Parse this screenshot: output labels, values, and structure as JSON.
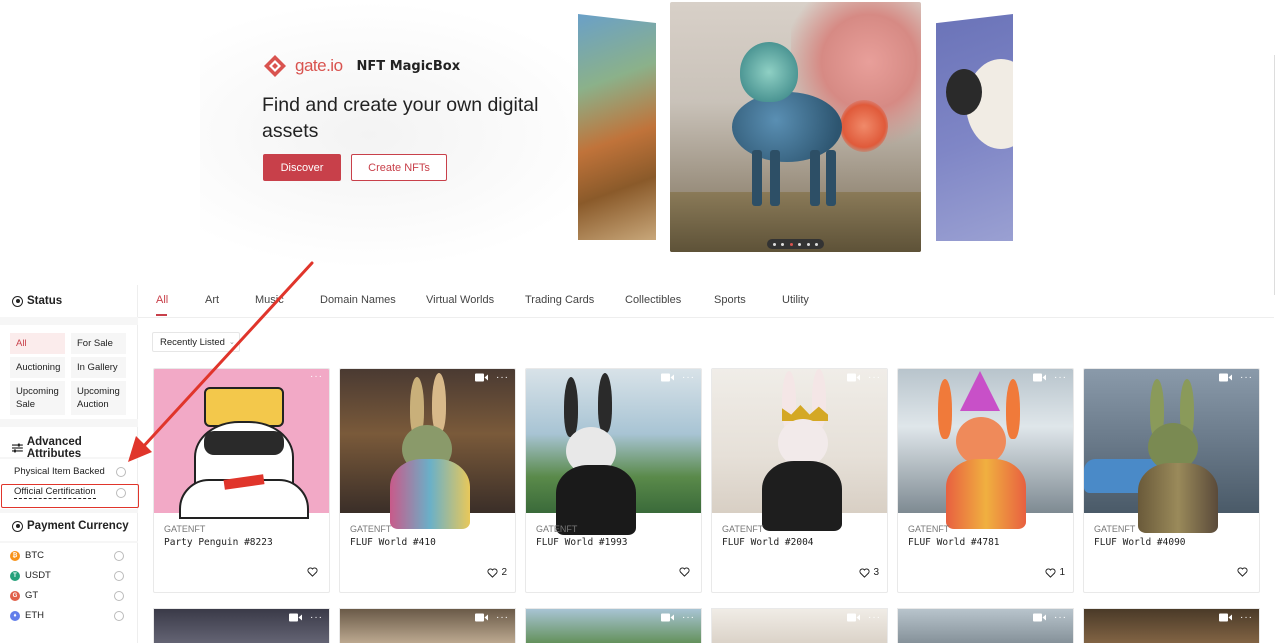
{
  "hero": {
    "brand_gate": "gate.io",
    "brand_name": "NFT MagicBox",
    "headline": "Find and create your own digital assets",
    "discover_label": "Discover",
    "create_label": "Create NFTs",
    "carousel_dots": 6,
    "carousel_active_index": 2
  },
  "sidebar": {
    "status_title": "Status",
    "status_buttons": [
      {
        "label": "All",
        "active": true
      },
      {
        "label": "For Sale",
        "active": false
      },
      {
        "label": "Auctioning",
        "active": false
      },
      {
        "label": "In Gallery",
        "active": false
      },
      {
        "label": "Upcoming Sale",
        "active": false
      },
      {
        "label": "Upcoming Auction",
        "active": false
      }
    ],
    "attributes_title": "Advanced Attributes",
    "attributes": [
      {
        "label": "Physical Item Backed"
      },
      {
        "label": "Official Certification"
      }
    ],
    "currency_title": "Payment Currency",
    "currencies": [
      {
        "label": "BTC",
        "color": "#f7931a",
        "glyph": "₿"
      },
      {
        "label": "USDT",
        "color": "#26a17b",
        "glyph": "T"
      },
      {
        "label": "GT",
        "color": "#e0604a",
        "glyph": "G"
      },
      {
        "label": "ETH",
        "color": "#627eea",
        "glyph": "♦"
      }
    ]
  },
  "tabs": [
    {
      "label": "All",
      "active": true
    },
    {
      "label": "Art"
    },
    {
      "label": "Music"
    },
    {
      "label": "Domain Names"
    },
    {
      "label": "Virtual Worlds"
    },
    {
      "label": "Trading Cards"
    },
    {
      "label": "Collectibles"
    },
    {
      "label": "Sports"
    },
    {
      "label": "Utility"
    }
  ],
  "sort": {
    "label": "Recently Listed"
  },
  "cards": [
    {
      "collection": "GATENFT",
      "title": "Party Penguin #8223",
      "likes": "",
      "video": false
    },
    {
      "collection": "GATENFT",
      "title": "FLUF World #410",
      "likes": "2",
      "video": true
    },
    {
      "collection": "GATENFT",
      "title": "FLUF World #1993",
      "likes": "",
      "video": true
    },
    {
      "collection": "GATENFT",
      "title": "FLUF World #2004",
      "likes": "3",
      "video": true
    },
    {
      "collection": "GATENFT",
      "title": "FLUF World #4781",
      "likes": "1",
      "video": true
    },
    {
      "collection": "GATENFT",
      "title": "FLUF World #4090",
      "likes": "",
      "video": true
    }
  ],
  "colors": {
    "accent": "#c8404a",
    "highlight": "#e0352b"
  }
}
